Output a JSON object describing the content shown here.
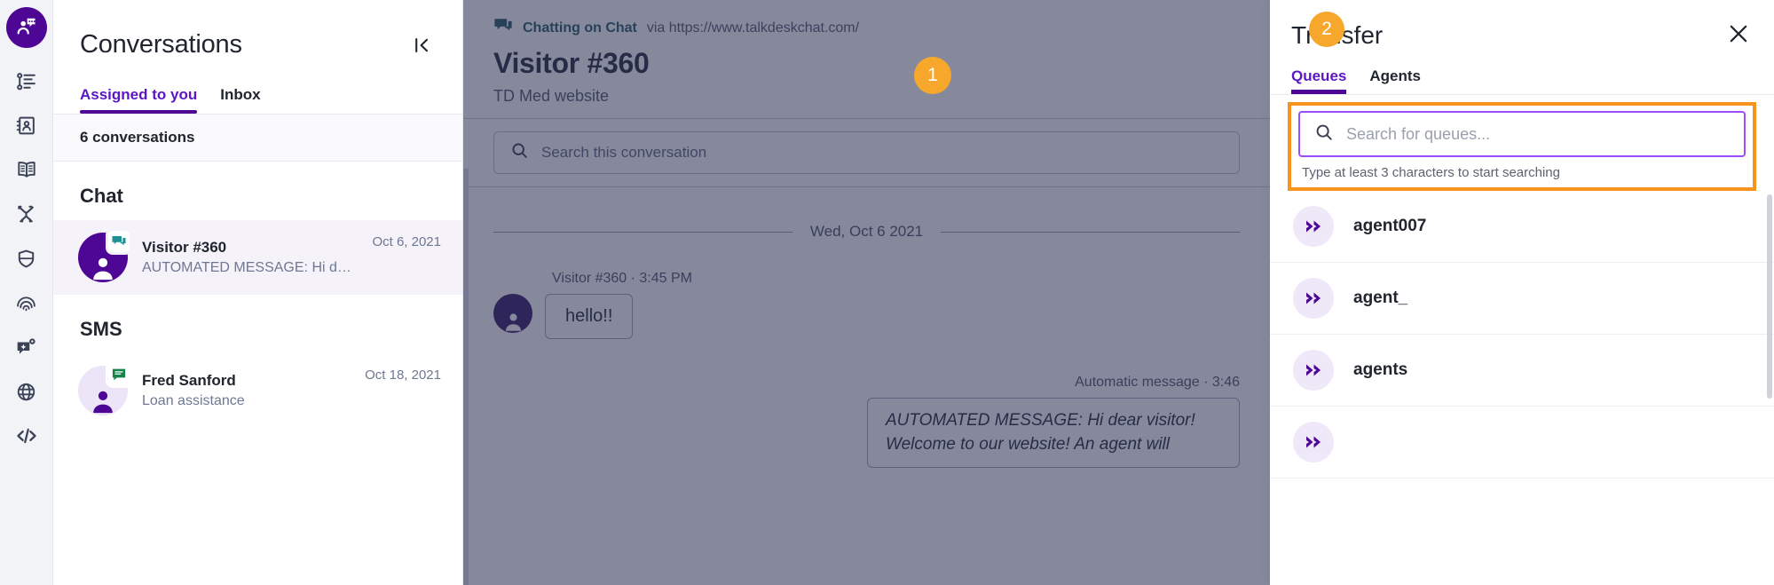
{
  "rail": {
    "logo_icon": "talkdesk-chat-logo-icon",
    "items": [
      {
        "icon": "activity-list-icon",
        "name": "rail-item-activity"
      },
      {
        "icon": "contacts-book-icon",
        "name": "rail-item-contacts"
      },
      {
        "icon": "knowledge-book-icon",
        "name": "rail-item-knowledge"
      },
      {
        "icon": "routing-flow-icon",
        "name": "rail-item-routing"
      },
      {
        "icon": "shield-icon",
        "name": "rail-item-shield"
      },
      {
        "icon": "fingerprint-icon",
        "name": "rail-item-fingerprint"
      },
      {
        "icon": "ai-message-gear-icon",
        "name": "rail-item-automation"
      },
      {
        "icon": "globe-icon",
        "name": "rail-item-globe"
      },
      {
        "icon": "code-icon",
        "name": "rail-item-developer"
      }
    ]
  },
  "conversations": {
    "title": "Conversations",
    "collapse_icon": "collapse-panel-icon",
    "tabs": [
      {
        "label": "Assigned to you",
        "active": true
      },
      {
        "label": "Inbox",
        "active": false
      }
    ],
    "count_label": "6 conversations",
    "groups": [
      {
        "label": "Chat",
        "items": [
          {
            "name": "Visitor #360",
            "preview": "AUTOMATED MESSAGE: Hi dea…",
            "date": "Oct 6, 2021",
            "badge_icon": "chat-badge-icon",
            "selected": true
          }
        ]
      },
      {
        "label": "SMS",
        "items": [
          {
            "name": "Fred Sanford",
            "preview": "Loan assistance",
            "date": "Oct 18, 2021",
            "badge_icon": "sms-badge-icon",
            "selected": false
          }
        ]
      }
    ]
  },
  "chat": {
    "channel_icon": "chat-channel-icon",
    "channel_label": "Chatting on Chat",
    "channel_via": "via https://www.talkdeskchat.com/",
    "title": "Visitor #360",
    "subtitle": "TD Med website",
    "search_icon": "search-icon",
    "search_placeholder": "Search this conversation",
    "day_separator": "Wed, Oct 6 2021",
    "messages": [
      {
        "author": "Visitor #360",
        "time": "3:45 PM",
        "meta": "Visitor #360 · 3:45 PM",
        "text": "hello!!",
        "side": "left"
      },
      {
        "author": "Automatic message",
        "time": "3:46",
        "meta": "Automatic message · 3:46",
        "text": "AUTOMATED MESSAGE: Hi dear visitor! Welcome to our website! An agent will",
        "side": "right"
      }
    ]
  },
  "transfer": {
    "title": "Transfer",
    "close_icon": "close-icon",
    "tabs": [
      {
        "label": "Queues",
        "active": true
      },
      {
        "label": "Agents",
        "active": false
      }
    ],
    "search_icon": "search-icon",
    "search_placeholder": "Search for queues...",
    "search_hint": "Type at least 3 characters to start searching",
    "queues": [
      {
        "name": "agent007",
        "icon": "queue-arrow-icon"
      },
      {
        "name": "agent_",
        "icon": "queue-arrow-icon"
      },
      {
        "name": "agents",
        "icon": "queue-arrow-icon"
      }
    ]
  },
  "markers": [
    {
      "id": "1",
      "label": "1"
    },
    {
      "id": "2",
      "label": "2"
    }
  ],
  "colors": {
    "brand_purple": "#4e0695",
    "accent_orange": "#f7941e",
    "tab_active": "#5c16c5",
    "teal": "#1c5561"
  }
}
